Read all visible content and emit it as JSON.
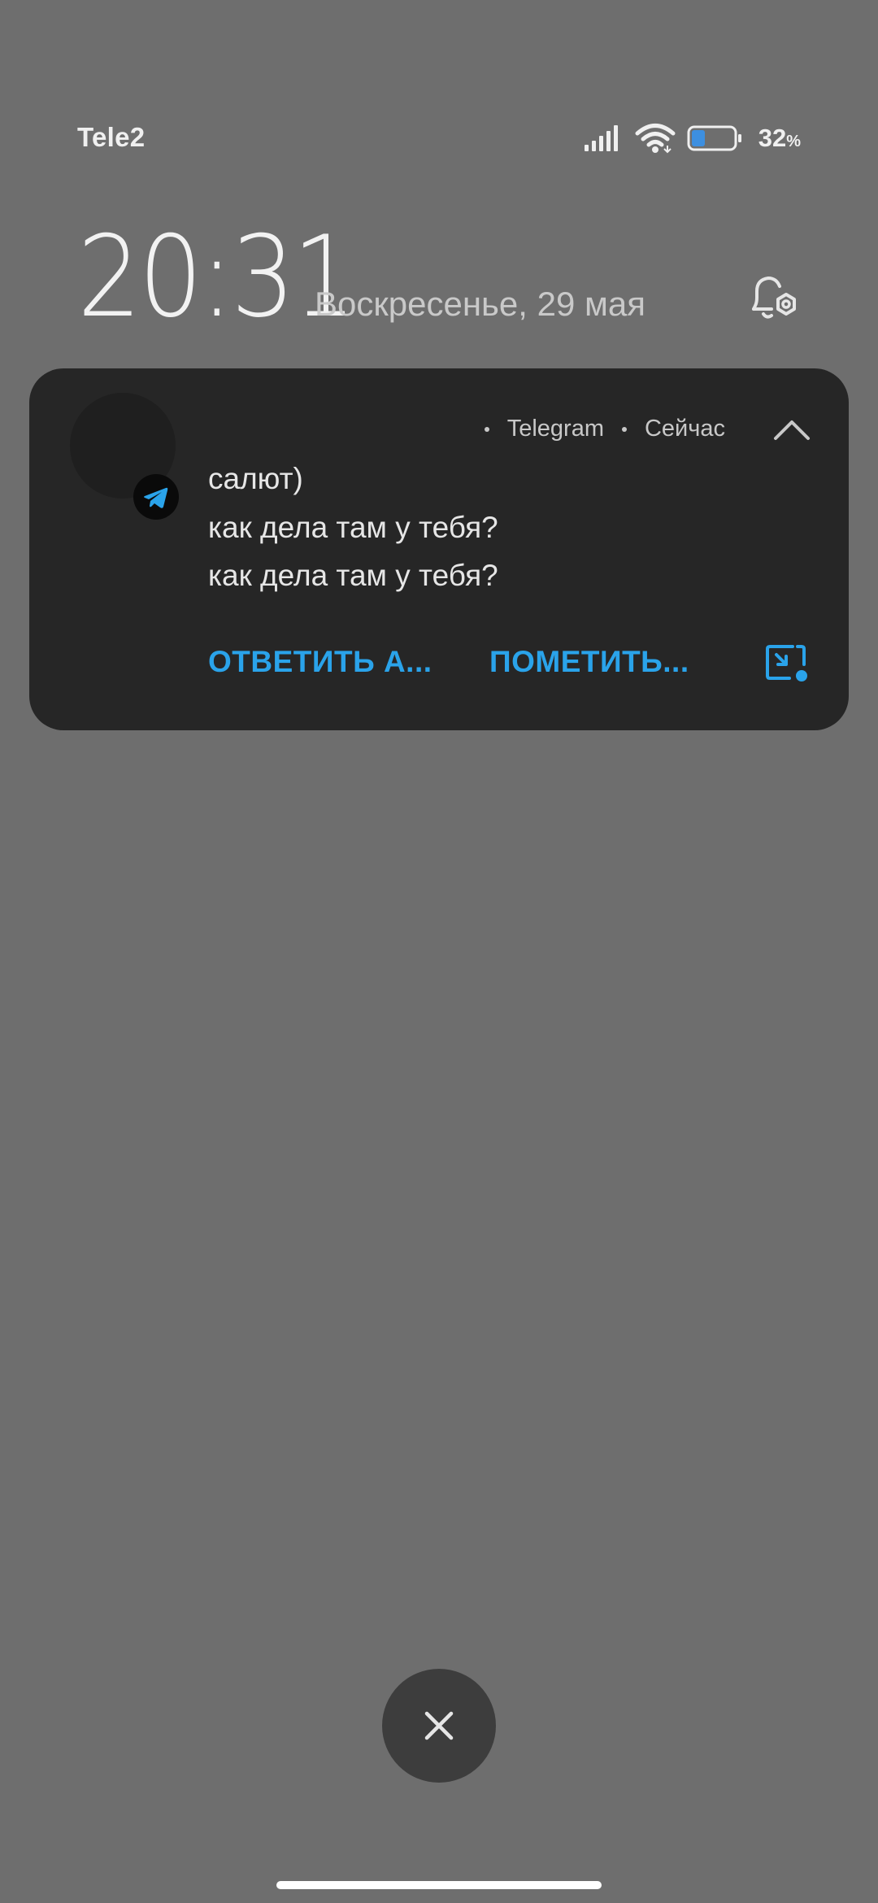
{
  "status_bar": {
    "carrier": "Tele2",
    "battery_percent": "32",
    "battery_unit": "%",
    "battery_level": 0.32,
    "icons": [
      "signal-icon",
      "wifi-icon",
      "battery-icon"
    ]
  },
  "lockscreen": {
    "time": "20:31",
    "date": "Воскресенье, 29 мая"
  },
  "notification": {
    "app_name": "Telegram",
    "time": "Сейчас",
    "messages": [
      "салют)",
      "как дела там у тебя?",
      "как дела там у тебя?"
    ],
    "actions": {
      "reply": "ОТВЕТИТЬ А...",
      "mark": "ПОМЕТИТЬ..."
    }
  },
  "colors": {
    "background": "#6e6e6e",
    "card": "#262626",
    "accent": "#2aa3ea"
  }
}
